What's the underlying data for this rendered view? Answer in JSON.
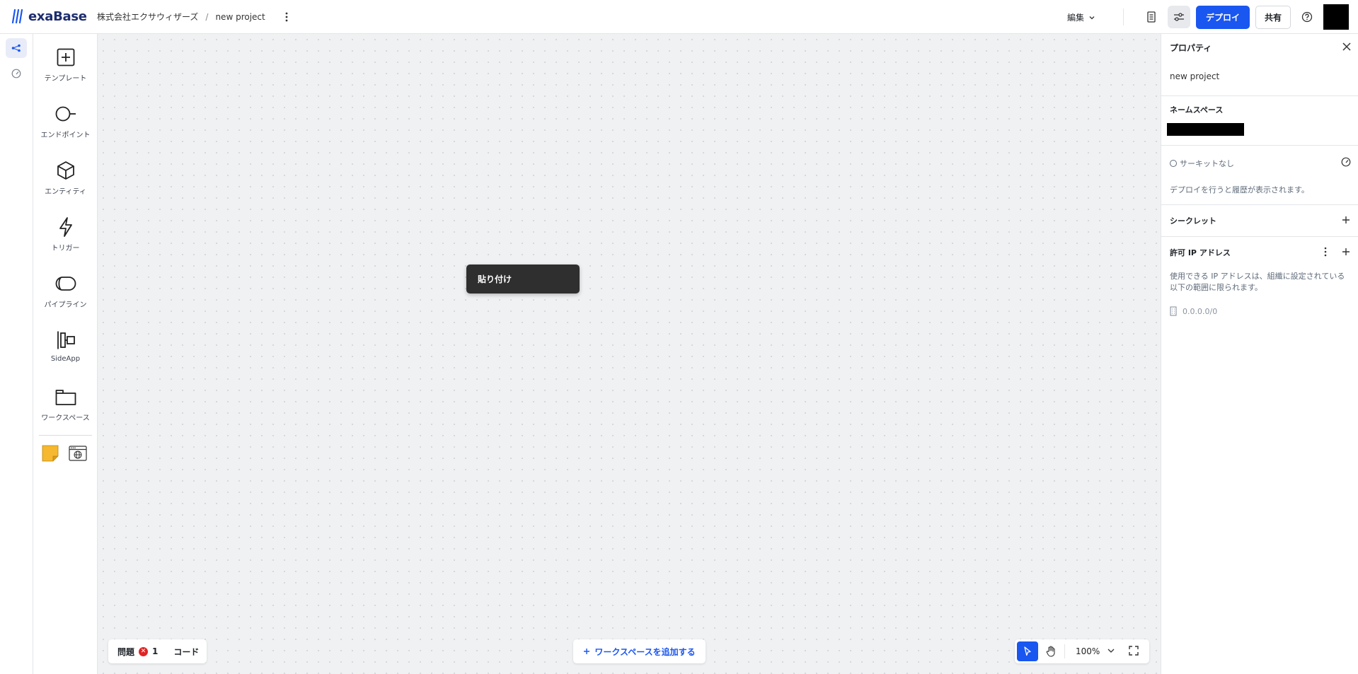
{
  "header": {
    "logo_text": "exaBase",
    "org_name": "株式会社エクサウィザーズ",
    "separator": "/",
    "project_name": "new project",
    "edit_label": "編集",
    "deploy_label": "デプロイ",
    "share_label": "共有"
  },
  "palette": {
    "items": [
      {
        "label": "テンプレート",
        "icon": "add-square-icon"
      },
      {
        "label": "エンドポイント",
        "icon": "endpoint-icon"
      },
      {
        "label": "エンティティ",
        "icon": "cube-icon"
      },
      {
        "label": "トリガー",
        "icon": "lightning-icon"
      },
      {
        "label": "パイプライン",
        "icon": "pipeline-icon"
      },
      {
        "label": "SideApp",
        "icon": "sideapp-icon"
      },
      {
        "label": "ワークスペース",
        "icon": "folder-icon"
      }
    ],
    "extras": [
      "sticky-note-icon",
      "web-app-icon"
    ]
  },
  "canvas": {
    "context_menu_paste": "貼り付け",
    "issues_label": "問題",
    "issues_count": "1",
    "code_label": "コード",
    "add_workspace_label": "ワークスペースを追加する",
    "zoom_level": "100%"
  },
  "panel": {
    "title": "プロパティ",
    "project_name": "new project",
    "namespace_title": "ネームスペース",
    "circuit_label": "サーキットなし",
    "deploy_history_msg": "デプロイを行うと履歴が表示されます。",
    "secret_title": "シークレット",
    "allowed_ip_title": "許可 IP アドレス",
    "allowed_ip_desc": "使用できる IP アドレスは、組織に設定されている以下の範囲に限られます。",
    "ip_range": "0.0.0.0/0"
  },
  "colors": {
    "accent": "#1a56f0",
    "error": "#e02424",
    "sticky": "#f5b82e"
  }
}
